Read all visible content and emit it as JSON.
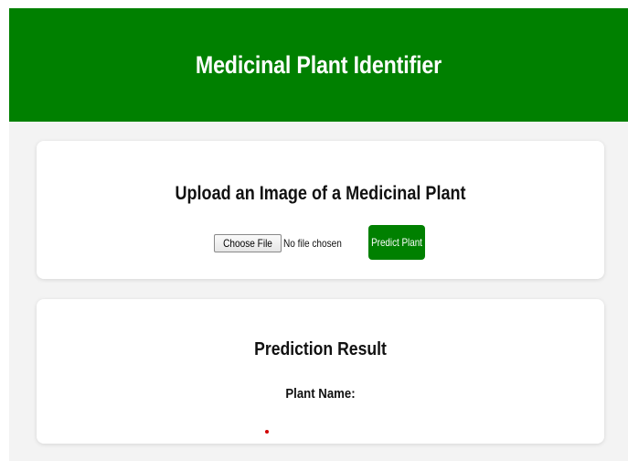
{
  "header": {
    "title": "Medicinal Plant Identifier",
    "background_color": "#008000"
  },
  "upload_card": {
    "title": "Upload an Image of a Medicinal Plant",
    "choose_file_label": "Choose File",
    "file_status": "No file chosen",
    "predict_button_label": "Predict Plant"
  },
  "result_card": {
    "title": "Prediction Result",
    "plant_name_label": "Plant Name:",
    "plant_name_value": ""
  },
  "colors": {
    "accent": "#008000",
    "page_background": "#f3f3f3",
    "card_background": "#ffffff",
    "result_value_color": "#d10000"
  }
}
